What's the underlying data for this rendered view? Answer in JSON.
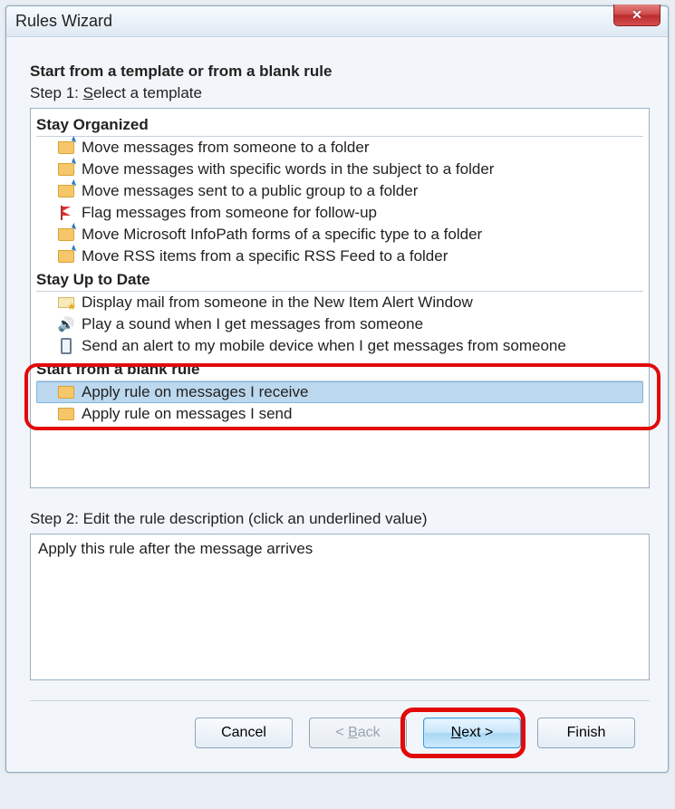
{
  "window": {
    "title": "Rules Wizard"
  },
  "intro": "Start from a template or from a blank rule",
  "step1": {
    "prefix": "Step 1: ",
    "u": "S",
    "suffix": "elect a template"
  },
  "sections": {
    "organized": {
      "title": "Stay Organized",
      "items": [
        "Move messages from someone to a folder",
        "Move messages with specific words in the subject to a folder",
        "Move messages sent to a public group to a folder",
        "Flag messages from someone for follow-up",
        "Move Microsoft InfoPath forms of a specific type to a folder",
        "Move RSS items from a specific RSS Feed to a folder"
      ]
    },
    "uptodate": {
      "title": "Stay Up to Date",
      "items": [
        "Display mail from someone in the New Item Alert Window",
        "Play a sound when I get messages from someone",
        "Send an alert to my mobile device when I get messages from someone"
      ]
    },
    "blank": {
      "title": "Start from a blank rule",
      "items": [
        "Apply rule on messages I receive",
        "Apply rule on messages I send"
      ]
    }
  },
  "step2": {
    "prefix": "Step 2: Edit the rule ",
    "u": "d",
    "suffix": "escription (click an underlined value)"
  },
  "description": "Apply this rule after the message arrives",
  "buttons": {
    "cancel": "Cancel",
    "back": {
      "lt": "< ",
      "u": "B",
      "rest": "ack"
    },
    "next": {
      "u": "N",
      "rest": "ext >"
    },
    "finish": "Finish"
  }
}
